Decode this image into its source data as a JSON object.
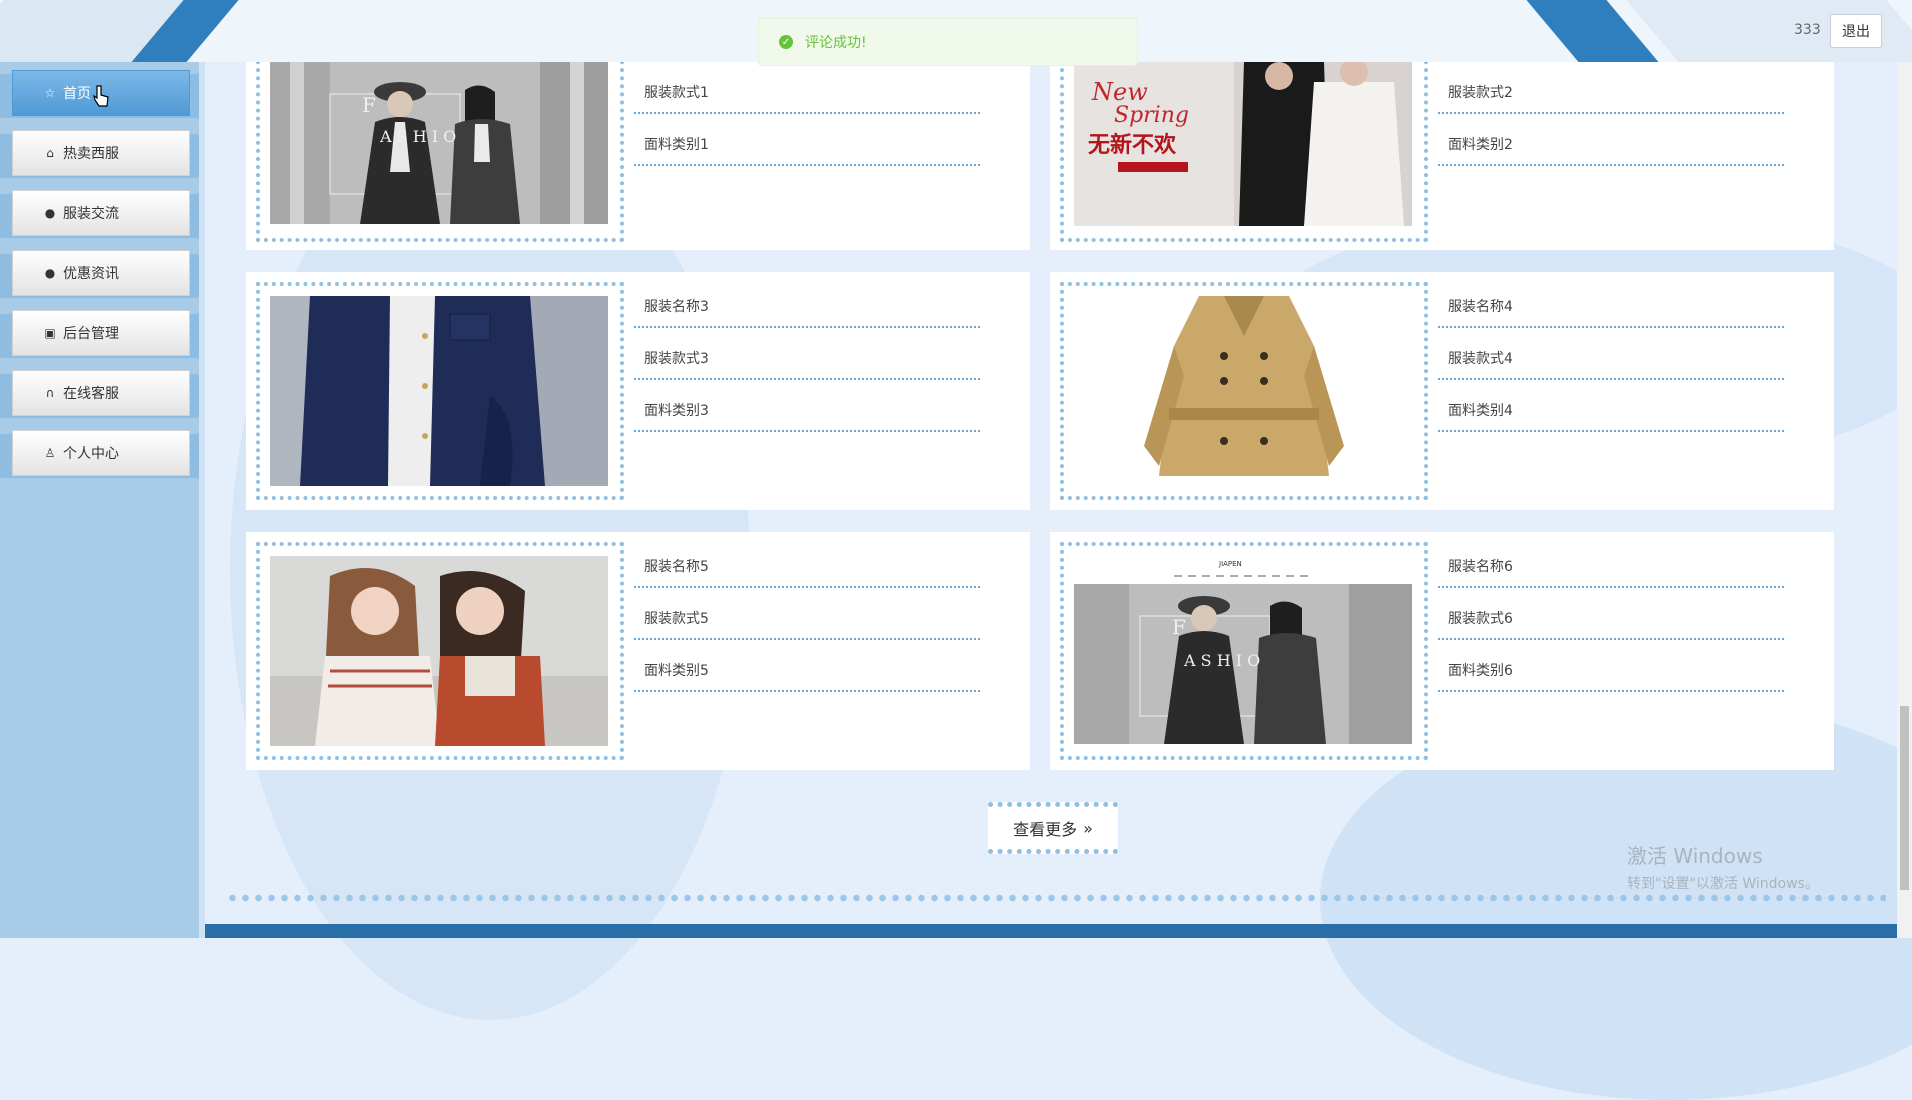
{
  "header": {
    "username": "333",
    "logout_label": "退出"
  },
  "toast": {
    "message": "评论成功!",
    "status": "success",
    "color": "#67c23a"
  },
  "sidebar": {
    "items": [
      {
        "label": "首页",
        "icon": "star-icon",
        "active": true
      },
      {
        "label": "热卖西服",
        "icon": "bag-icon",
        "active": false
      },
      {
        "label": "服装交流",
        "icon": "alert-circle-icon",
        "active": false
      },
      {
        "label": "优惠资讯",
        "icon": "question-circle-icon",
        "active": false
      },
      {
        "label": "后台管理",
        "icon": "briefcase-icon",
        "active": false
      },
      {
        "label": "在线客服",
        "icon": "headset-icon",
        "active": false
      },
      {
        "label": "个人中心",
        "icon": "user-icon",
        "active": false
      }
    ]
  },
  "products": [
    {
      "style": "服装款式1",
      "fabric": "面料类别1",
      "image": "fashion-poster-image"
    },
    {
      "style": "服装款式2",
      "fabric": "面料类别2",
      "image": "new-spring-poster-image",
      "poster_text": {
        "line1": "New",
        "line2": "Spring",
        "line3": "无新不欢"
      }
    },
    {
      "name": "服装名称3",
      "style": "服装款式3",
      "fabric": "面料类别3",
      "image": "denim-jacket-image"
    },
    {
      "name": "服装名称4",
      "style": "服装款式4",
      "fabric": "面料类别4",
      "image": "trench-coat-image"
    },
    {
      "name": "服装名称5",
      "style": "服装款式5",
      "fabric": "面料类别5",
      "image": "two-girls-image"
    },
    {
      "name": "服装名称6",
      "style": "服装款式6",
      "fabric": "面料类别6",
      "image": "japen-fashion-image"
    }
  ],
  "more_button": {
    "label": "查看更多"
  },
  "watermark": {
    "line1": "激活 Windows",
    "line2": "转到\"设置\"以激活 Windows。"
  },
  "colors": {
    "accent": "#2f7fbe",
    "sidebar": "#a8cbe8",
    "dotted": "#8fc0e4"
  }
}
